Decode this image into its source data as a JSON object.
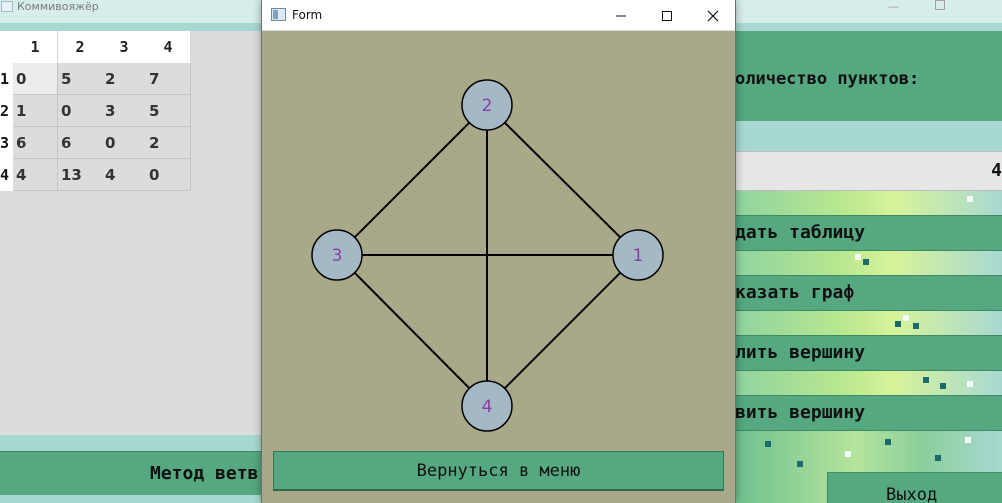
{
  "main_window": {
    "title": "Коммивояжёр",
    "min_glyph": "—",
    "matrix": {
      "column_headers": [
        "1",
        "2",
        "3",
        "4"
      ],
      "row_headers": [
        "1",
        "2",
        "3",
        "4"
      ],
      "rows": [
        [
          "0",
          "5",
          "2",
          "7"
        ],
        [
          "1",
          "0",
          "3",
          "5"
        ],
        [
          "6",
          "6",
          "0",
          "2"
        ],
        [
          "4",
          "13",
          "4",
          "0"
        ]
      ]
    },
    "branch_method_label": "Метод ветв",
    "count_label": "оличество пунктов:",
    "count_value": "4",
    "buttons": {
      "set_table": "дать таблицу",
      "show_graph": "казать граф",
      "delete_vertex": "лить вершину",
      "add_vertex": "вить вершину"
    },
    "exit_label": "Выход"
  },
  "dialog": {
    "title": "Form",
    "back_label": "Вернуться в меню",
    "graph": {
      "node_fill": "#a5b8c6",
      "label_color": "#8a3fa5",
      "nodes": [
        {
          "label": "1"
        },
        {
          "label": "2"
        },
        {
          "label": "3"
        },
        {
          "label": "4"
        }
      ],
      "edges": [
        [
          "2",
          "3"
        ],
        [
          "2",
          "1"
        ],
        [
          "2",
          "4"
        ],
        [
          "3",
          "1"
        ],
        [
          "3",
          "4"
        ],
        [
          "1",
          "4"
        ]
      ]
    }
  },
  "colors": {
    "button_green": "#55a880",
    "dialog_bg": "#a9a888",
    "main_bg": "#a7d8d1"
  }
}
